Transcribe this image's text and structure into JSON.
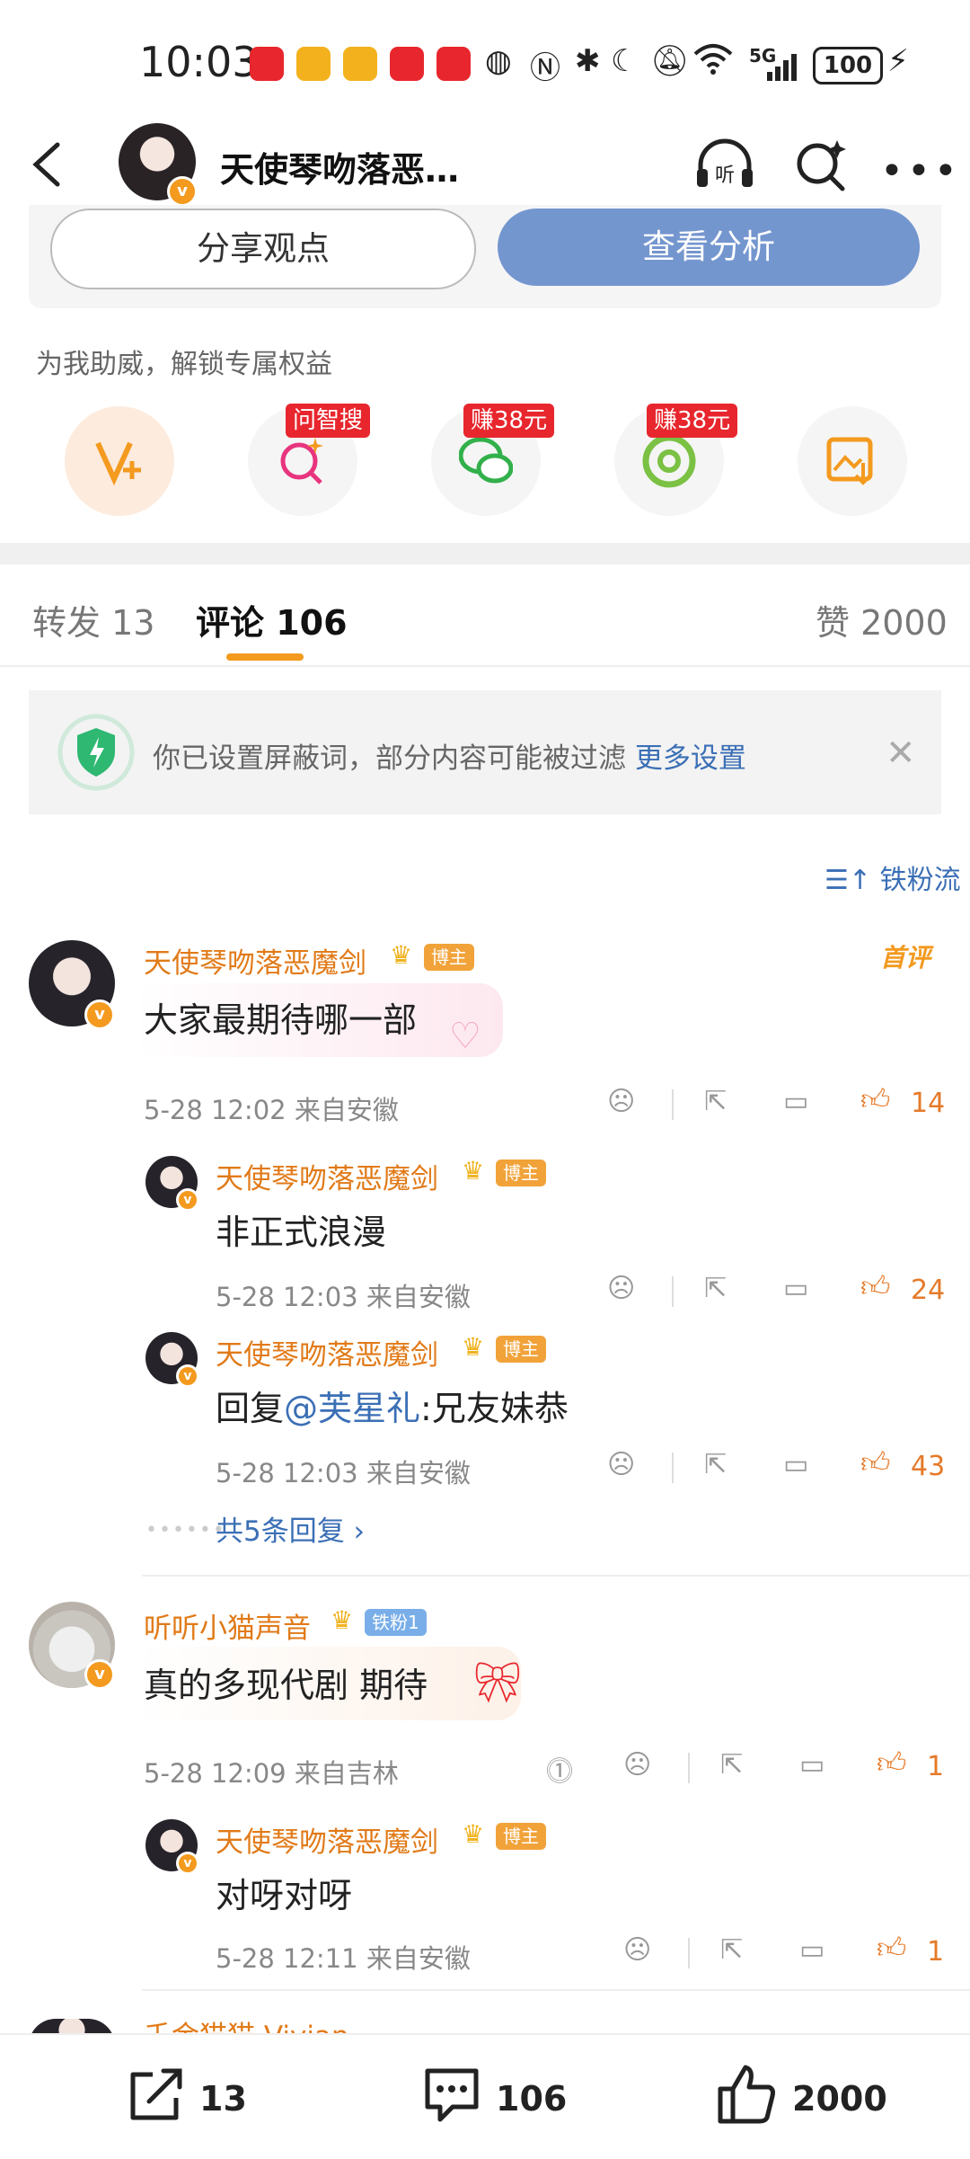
{
  "status_bar": {
    "time": "10:03",
    "network": "5G",
    "battery": "100"
  },
  "header": {
    "title": "天使琴吻落恶…"
  },
  "actions": {
    "share_label": "分享观点",
    "analyse_label": "查看分析"
  },
  "support": {
    "text": "为我助威，解锁专属权益",
    "tags": [
      "问智搜",
      "赚38元",
      "赚38元"
    ]
  },
  "tabs": {
    "repost": "转发 13",
    "comment": "评论 106",
    "like": "赞 2000"
  },
  "notice": {
    "text": "你已设置屏蔽词，部分内容可能被过滤 ",
    "link": "更多设置"
  },
  "sort_label": "铁粉流",
  "comments": [
    {
      "user": "天使琴吻落恶魔剑",
      "role": "博主",
      "text": "大家最期待哪一部",
      "meta": "5-28 12:02 来自安徽",
      "likes": "14",
      "badge": "首评",
      "replies": [
        {
          "user": "天使琴吻落恶魔剑",
          "role": "博主",
          "text": "非正式浪漫",
          "meta": "5-28 12:03 来自安徽",
          "likes": "24"
        },
        {
          "user": "天使琴吻落恶魔剑",
          "role": "博主",
          "text_prefix": "回复",
          "mention": "@芙星礼",
          "text_suffix": ":兄友妹恭",
          "meta": "5-28 12:03 来自安徽",
          "likes": "43"
        }
      ],
      "more_replies": "共5条回复"
    },
    {
      "user": "听听小猫声音",
      "role": "铁粉1",
      "text": "真的多现代剧 期待",
      "meta": "5-28 12:09 来自吉林",
      "likes": "1",
      "replies": [
        {
          "user": "天使琴吻落恶魔剑",
          "role": "博主",
          "text": "对呀对呀",
          "meta": "5-28 12:11 来自安徽",
          "likes": "1"
        }
      ]
    }
  ],
  "next_user_partial": "千金猫猫 Vivian",
  "bottom_bar": {
    "repost": "13",
    "comment": "106",
    "like": "2000"
  }
}
